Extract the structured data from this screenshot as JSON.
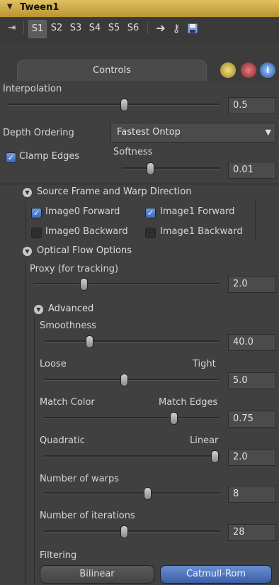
{
  "header": {
    "title": "Tween1"
  },
  "toolbar": {
    "slots": [
      "S1",
      "S2",
      "S3",
      "S4",
      "S5",
      "S6"
    ]
  },
  "tabs": {
    "controls": "Controls"
  },
  "interpolation": {
    "label": "Interpolation",
    "value": "0.5",
    "level": 0.5
  },
  "depth_ordering": {
    "label": "Depth Ordering",
    "value": "Fastest Ontop"
  },
  "clamp_edges": {
    "label": "Clamp Edges",
    "checked": true
  },
  "softness": {
    "label": "Softness",
    "value": "0.01"
  },
  "source_frame": {
    "title": "Source Frame and Warp Direction",
    "image0_forward": "Image0 Forward",
    "image1_forward": "Image1 Forward",
    "image0_backward": "Image0 Backward",
    "image1_backward": "Image1 Backward"
  },
  "optical_flow": {
    "title": "Optical Flow Options"
  },
  "proxy": {
    "label": "Proxy (for tracking)",
    "value": "2.0"
  },
  "advanced": {
    "title": "Advanced"
  },
  "smoothness": {
    "label": "Smoothness",
    "value": "40.0"
  },
  "loose_tight": {
    "left": "Loose",
    "right": "Tight",
    "value": "5.0"
  },
  "match": {
    "left": "Match Color",
    "right": "Match Edges",
    "value": "0.75"
  },
  "quad_linear": {
    "left": "Quadratic",
    "right": "Linear",
    "value": "2.0"
  },
  "warps": {
    "label": "Number of warps",
    "value": "8"
  },
  "iterations": {
    "label": "Number of iterations",
    "value": "28"
  },
  "filtering": {
    "label": "Filtering",
    "bilinear": "Bilinear",
    "catmull": "Catmull-Rom"
  },
  "colors": {
    "header": "#d0ab45",
    "accent": "#4a72c0"
  }
}
